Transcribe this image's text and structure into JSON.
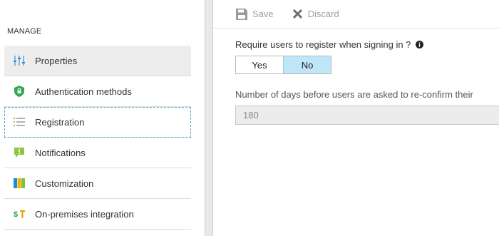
{
  "sidebar": {
    "section_header": "MANAGE",
    "items": [
      {
        "label": "Properties",
        "icon": "properties-icon"
      },
      {
        "label": "Authentication methods",
        "icon": "shield-icon"
      },
      {
        "label": "Registration",
        "icon": "list-icon"
      },
      {
        "label": "Notifications",
        "icon": "notification-icon"
      },
      {
        "label": "Customization",
        "icon": "customization-icon"
      },
      {
        "label": "On-premises integration",
        "icon": "integration-icon"
      }
    ]
  },
  "toolbar": {
    "save_label": "Save",
    "discard_label": "Discard"
  },
  "main": {
    "require_question": "Require users to register when signing in ?",
    "toggle": {
      "yes_label": "Yes",
      "no_label": "No",
      "selected": "No"
    },
    "days_label": "Number of days before users are asked to re-confirm their",
    "days_value": "180"
  },
  "colors": {
    "accent_selected": "#bfe6f7",
    "selection_outline": "#5aa4c8",
    "disabled_text": "#a0a0a0"
  }
}
